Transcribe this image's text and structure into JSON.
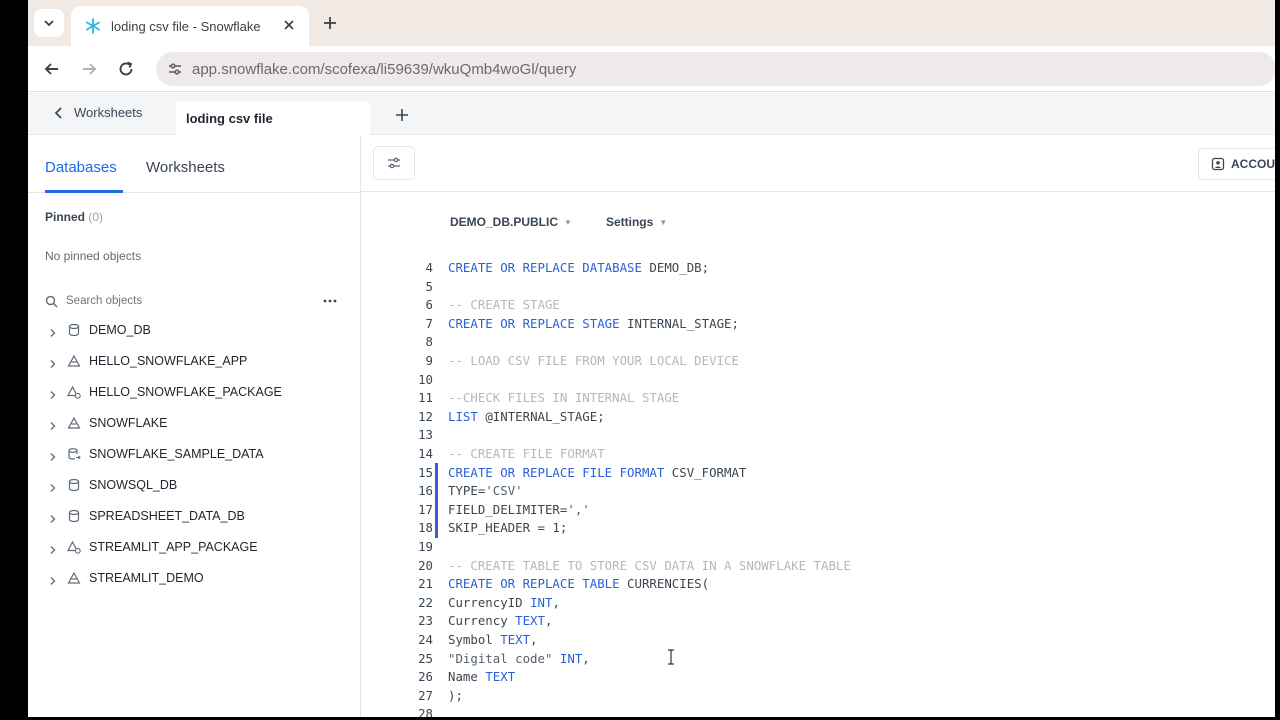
{
  "browser": {
    "tab_title": "loding csv file - Snowflake",
    "url": "app.snowflake.com/scofexa/li59639/wkuQmb4woGl/query"
  },
  "worksheet_bar": {
    "back_label": "Worksheets",
    "active_tab": "loding csv file"
  },
  "sidebar": {
    "tabs": [
      {
        "label": "Databases",
        "active": true
      },
      {
        "label": "Worksheets",
        "active": false
      }
    ],
    "pinned_label": "Pinned",
    "pinned_count": "(0)",
    "no_pinned": "No pinned objects",
    "search_placeholder": "Search objects",
    "databases": [
      {
        "name": "DEMO_DB",
        "icon": "database-icon"
      },
      {
        "name": "HELLO_SNOWFLAKE_APP",
        "icon": "app-icon"
      },
      {
        "name": "HELLO_SNOWFLAKE_PACKAGE",
        "icon": "app-package-icon"
      },
      {
        "name": "SNOWFLAKE",
        "icon": "app-icon"
      },
      {
        "name": "SNOWFLAKE_SAMPLE_DATA",
        "icon": "shared-database-icon"
      },
      {
        "name": "SNOWSQL_DB",
        "icon": "database-icon"
      },
      {
        "name": "SPREADSHEET_DATA_DB",
        "icon": "database-icon"
      },
      {
        "name": "STREAMLIT_APP_PACKAGE",
        "icon": "app-package-icon"
      },
      {
        "name": "STREAMLIT_DEMO",
        "icon": "app-icon"
      }
    ]
  },
  "editor": {
    "account_label": "ACCOU",
    "context": "DEMO_DB.PUBLIC",
    "settings": "Settings",
    "lines": [
      {
        "n": "4",
        "parts": [
          [
            "kw",
            "CREATE OR REPLACE DATABASE "
          ],
          [
            "tx",
            "DEMO_DB;"
          ]
        ]
      },
      {
        "n": "5",
        "parts": []
      },
      {
        "n": "6",
        "parts": [
          [
            "cm",
            "-- CREATE STAGE"
          ]
        ]
      },
      {
        "n": "7",
        "parts": [
          [
            "kw",
            "CREATE OR REPLACE STAGE "
          ],
          [
            "tx",
            "INTERNAL_STAGE;"
          ]
        ]
      },
      {
        "n": "8",
        "parts": []
      },
      {
        "n": "9",
        "parts": [
          [
            "cm",
            "-- LOAD CSV FILE FROM YOUR LOCAL DEVICE"
          ]
        ]
      },
      {
        "n": "10",
        "parts": []
      },
      {
        "n": "11",
        "parts": [
          [
            "cm",
            "--CHECK FILES IN INTERNAL STAGE"
          ]
        ]
      },
      {
        "n": "12",
        "parts": [
          [
            "kw",
            "LIST "
          ],
          [
            "tx",
            "@INTERNAL_STAGE;"
          ]
        ]
      },
      {
        "n": "13",
        "parts": []
      },
      {
        "n": "14",
        "parts": [
          [
            "cm",
            "-- CREATE FILE FORMAT"
          ]
        ]
      },
      {
        "n": "15",
        "parts": [
          [
            "kw",
            "CREATE OR REPLACE FILE FORMAT "
          ],
          [
            "tx",
            "CSV_FORMAT"
          ]
        ]
      },
      {
        "n": "16",
        "parts": [
          [
            "tx",
            "TYPE="
          ],
          [
            "str",
            "'CSV'"
          ]
        ]
      },
      {
        "n": "17",
        "parts": [
          [
            "tx",
            "FIELD_DELIMITER="
          ],
          [
            "str",
            "','"
          ]
        ]
      },
      {
        "n": "18",
        "parts": [
          [
            "tx",
            "SKIP_HEADER = 1;"
          ]
        ]
      },
      {
        "n": "19",
        "parts": []
      },
      {
        "n": "20",
        "parts": [
          [
            "cm",
            "-- CREATE TABLE TO STORE CSV DATA IN A SNOWFLAKE TABLE"
          ]
        ]
      },
      {
        "n": "21",
        "parts": [
          [
            "kw",
            "CREATE OR REPLACE TABLE "
          ],
          [
            "tx",
            "CURRENCIES("
          ]
        ]
      },
      {
        "n": "22",
        "parts": [
          [
            "tx",
            "CurrencyID "
          ],
          [
            "kw",
            "INT"
          ],
          [
            "tx",
            ","
          ]
        ]
      },
      {
        "n": "23",
        "parts": [
          [
            "tx",
            "Currency "
          ],
          [
            "kw",
            "TEXT"
          ],
          [
            "tx",
            ","
          ]
        ]
      },
      {
        "n": "24",
        "parts": [
          [
            "tx",
            "Symbol "
          ],
          [
            "kw",
            "TEXT"
          ],
          [
            "tx",
            ","
          ]
        ]
      },
      {
        "n": "25",
        "parts": [
          [
            "str",
            "\"Digital code\" "
          ],
          [
            "kw",
            "INT"
          ],
          [
            "tx",
            ","
          ]
        ]
      },
      {
        "n": "26",
        "parts": [
          [
            "tx",
            "Name "
          ],
          [
            "kw",
            "TEXT"
          ]
        ]
      },
      {
        "n": "27",
        "parts": [
          [
            "tx",
            ");"
          ]
        ]
      },
      {
        "n": "28",
        "parts": []
      }
    ]
  }
}
